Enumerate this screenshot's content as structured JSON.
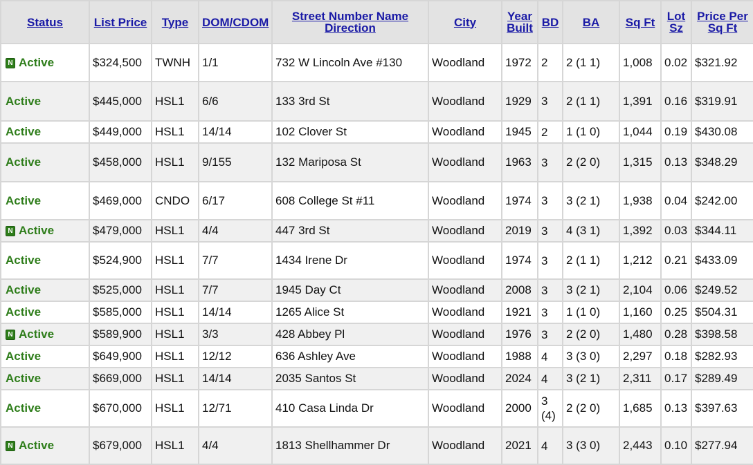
{
  "columns": [
    {
      "key": "status",
      "label": "Status"
    },
    {
      "key": "list_price",
      "label": "List Price"
    },
    {
      "key": "type",
      "label": "Type"
    },
    {
      "key": "dom_cdom",
      "label": "DOM/CDOM"
    },
    {
      "key": "address",
      "label": "Street Number Name Direction"
    },
    {
      "key": "city",
      "label": "City"
    },
    {
      "key": "year_built",
      "label": "Year Built"
    },
    {
      "key": "bd",
      "label": "BD"
    },
    {
      "key": "ba",
      "label": "BA"
    },
    {
      "key": "sqft",
      "label": "Sq Ft"
    },
    {
      "key": "lot_sz",
      "label": "Lot Sz"
    },
    {
      "key": "price_per_sqft",
      "label": "Price Per Sq Ft"
    }
  ],
  "new_badge": "N",
  "rows": [
    {
      "new": true,
      "status": "Active",
      "list_price": "$324,500",
      "type": "TWNH",
      "dom_cdom": "1/1",
      "address": "732 W Lincoln Ave #130",
      "city": "Woodland",
      "year_built": "1972",
      "bd": "2",
      "ba": "2 (1 1)",
      "sqft": "1,008",
      "lot_sz": "0.02",
      "price_per_sqft": "$321.92"
    },
    {
      "new": false,
      "status": "Active",
      "list_price": "$445,000",
      "type": "HSL1",
      "dom_cdom": "6/6",
      "address": "133 3rd St",
      "city": "Woodland",
      "year_built": "1929",
      "bd": "3",
      "ba": "2 (1 1)",
      "sqft": "1,391",
      "lot_sz": "0.16",
      "price_per_sqft": "$319.91"
    },
    {
      "new": false,
      "status": "Active",
      "list_price": "$449,000",
      "type": "HSL1",
      "dom_cdom": "14/14",
      "address": "102 Clover St",
      "city": "Woodland",
      "year_built": "1945",
      "bd": "2",
      "ba": "1 (1 0)",
      "sqft": "1,044",
      "lot_sz": "0.19",
      "price_per_sqft": "$430.08"
    },
    {
      "new": false,
      "status": "Active",
      "list_price": "$458,000",
      "type": "HSL1",
      "dom_cdom": "9/155",
      "address": "132 Mariposa St",
      "city": "Woodland",
      "year_built": "1963",
      "bd": "3",
      "ba": "2 (2 0)",
      "sqft": "1,315",
      "lot_sz": "0.13",
      "price_per_sqft": "$348.29"
    },
    {
      "new": false,
      "status": "Active",
      "list_price": "$469,000",
      "type": "CNDO",
      "dom_cdom": "6/17",
      "address": "608 College St #11",
      "city": "Woodland",
      "year_built": "1974",
      "bd": "3",
      "ba": "3 (2 1)",
      "sqft": "1,938",
      "lot_sz": "0.04",
      "price_per_sqft": "$242.00"
    },
    {
      "new": true,
      "status": "Active",
      "list_price": "$479,000",
      "type": "HSL1",
      "dom_cdom": "4/4",
      "address": "447 3rd St",
      "city": "Woodland",
      "year_built": "2019",
      "bd": "3",
      "ba": "4 (3 1)",
      "sqft": "1,392",
      "lot_sz": "0.03",
      "price_per_sqft": "$344.11"
    },
    {
      "new": false,
      "status": "Active",
      "list_price": "$524,900",
      "type": "HSL1",
      "dom_cdom": "7/7",
      "address": "1434 Irene Dr",
      "city": "Woodland",
      "year_built": "1974",
      "bd": "3",
      "ba": "2 (1 1)",
      "sqft": "1,212",
      "lot_sz": "0.21",
      "price_per_sqft": "$433.09"
    },
    {
      "new": false,
      "status": "Active",
      "list_price": "$525,000",
      "type": "HSL1",
      "dom_cdom": "7/7",
      "address": "1945 Day Ct",
      "city": "Woodland",
      "year_built": "2008",
      "bd": "3",
      "ba": "3 (2 1)",
      "sqft": "2,104",
      "lot_sz": "0.06",
      "price_per_sqft": "$249.52"
    },
    {
      "new": false,
      "status": "Active",
      "list_price": "$585,000",
      "type": "HSL1",
      "dom_cdom": "14/14",
      "address": "1265 Alice St",
      "city": "Woodland",
      "year_built": "1921",
      "bd": "3",
      "ba": "1 (1 0)",
      "sqft": "1,160",
      "lot_sz": "0.25",
      "price_per_sqft": "$504.31"
    },
    {
      "new": true,
      "status": "Active",
      "list_price": "$589,900",
      "type": "HSL1",
      "dom_cdom": "3/3",
      "address": "428 Abbey Pl",
      "city": "Woodland",
      "year_built": "1976",
      "bd": "3",
      "ba": "2 (2 0)",
      "sqft": "1,480",
      "lot_sz": "0.28",
      "price_per_sqft": "$398.58"
    },
    {
      "new": false,
      "status": "Active",
      "list_price": "$649,900",
      "type": "HSL1",
      "dom_cdom": "12/12",
      "address": "636 Ashley Ave",
      "city": "Woodland",
      "year_built": "1988",
      "bd": "4",
      "ba": "3 (3 0)",
      "sqft": "2,297",
      "lot_sz": "0.18",
      "price_per_sqft": "$282.93"
    },
    {
      "new": false,
      "status": "Active",
      "list_price": "$669,000",
      "type": "HSL1",
      "dom_cdom": "14/14",
      "address": "2035 Santos St",
      "city": "Woodland",
      "year_built": "2024",
      "bd": "4",
      "ba": "3 (2 1)",
      "sqft": "2,311",
      "lot_sz": "0.17",
      "price_per_sqft": "$289.49"
    },
    {
      "new": false,
      "status": "Active",
      "list_price": "$670,000",
      "type": "HSL1",
      "dom_cdom": "12/71",
      "address": "410 Casa Linda Dr",
      "city": "Woodland",
      "year_built": "2000",
      "bd": "3 (4)",
      "ba": "2 (2 0)",
      "sqft": "1,685",
      "lot_sz": "0.13",
      "price_per_sqft": "$397.63"
    },
    {
      "new": true,
      "status": "Active",
      "list_price": "$679,000",
      "type": "HSL1",
      "dom_cdom": "4/4",
      "address": "1813 Shellhammer Dr",
      "city": "Woodland",
      "year_built": "2021",
      "bd": "4",
      "ba": "3 (3 0)",
      "sqft": "2,443",
      "lot_sz": "0.10",
      "price_per_sqft": "$277.94"
    }
  ]
}
